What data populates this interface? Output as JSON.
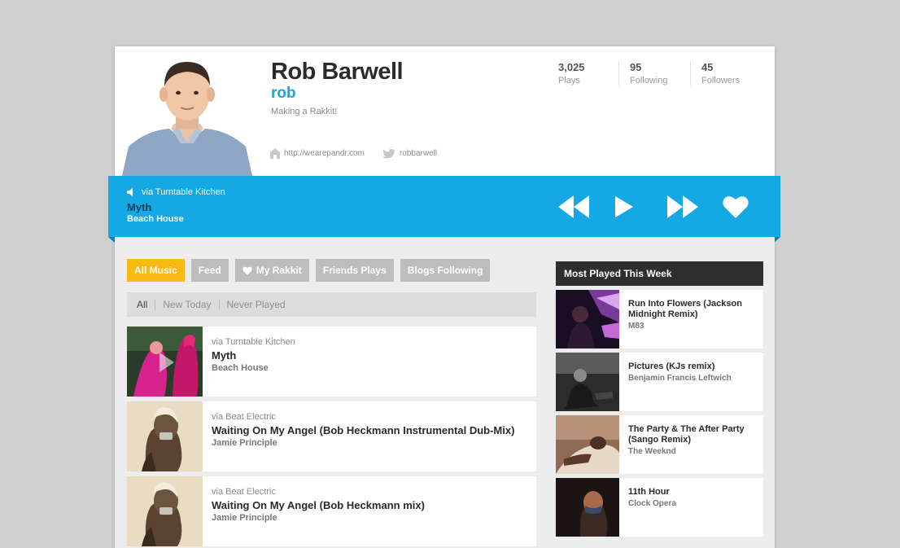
{
  "profile": {
    "name": "Rob Barwell",
    "username": "rob",
    "bio": "Making a Rakkit!",
    "website": "http://wearepandr.com",
    "twitter": "robbarwell"
  },
  "stats": [
    {
      "value": "3,025",
      "label": "Plays"
    },
    {
      "value": "95",
      "label": "Following"
    },
    {
      "value": "45",
      "label": "Followers"
    }
  ],
  "player": {
    "source": "via Turntable Kitchen",
    "title": "Myth",
    "artist": "Beach House",
    "controls": [
      "rewind-icon",
      "play-icon",
      "fast-forward-icon",
      "heart-icon"
    ]
  },
  "tabs": [
    "All Music",
    "Feed",
    "My Rakkit",
    "Friends Plays",
    "Blogs Following"
  ],
  "filters": [
    "All",
    "New Today",
    "Never Played"
  ],
  "tracks": [
    {
      "source": "via Turntable Kitchen",
      "title": "Myth",
      "artist": "Beach House"
    },
    {
      "source": "via Beat Electric",
      "title": "Waiting On My Angel (Bob Heckmann Instrumental Dub-Mix)",
      "artist": "Jamie Principle"
    },
    {
      "source": "via Beat Electric",
      "title": "Waiting On My Angel (Bob Heckmann mix)",
      "artist": "Jamie Principle"
    }
  ],
  "most_played": {
    "header": "Most Played This Week",
    "items": [
      {
        "title": "Run Into Flowers (Jackson Midnight Remix)",
        "artist": "M83"
      },
      {
        "title": "Pictures (KJs remix)",
        "artist": "Benjamin Francis Leftwich"
      },
      {
        "title": "The Party & The After Party (Sango Remix)",
        "artist": "The Weeknd"
      },
      {
        "title": "11th Hour",
        "artist": "Clock Opera"
      }
    ]
  },
  "colors": {
    "accent": "#15a8e4",
    "active_tab": "#f8b912",
    "tab": "#bdbdbd",
    "dark_header": "#2e2e2e"
  }
}
